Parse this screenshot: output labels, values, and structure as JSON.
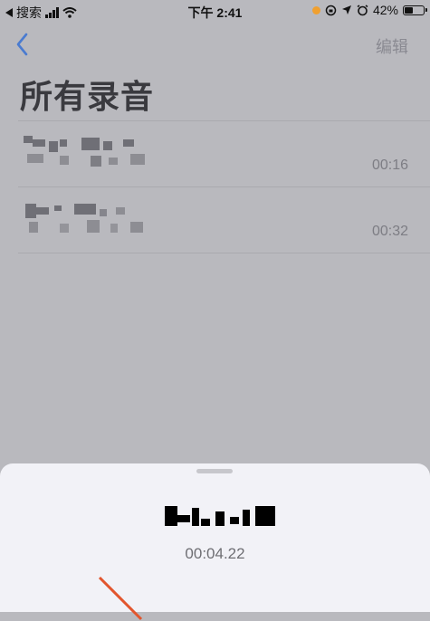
{
  "status_bar": {
    "back_app": "搜索",
    "time": "下午 2:41",
    "battery": "42%"
  },
  "nav": {
    "edit_label": "编辑"
  },
  "page": {
    "title": "所有录音"
  },
  "recordings": [
    {
      "duration": "00:16"
    },
    {
      "duration": "00:32"
    }
  ],
  "recording_sheet": {
    "elapsed": "00:04.22"
  },
  "colors": {
    "overlay": "#b9b9be",
    "sheet": "#f2f2f7",
    "accent_blue": "#4a7bd0",
    "waveform_line": "#e2552d"
  }
}
